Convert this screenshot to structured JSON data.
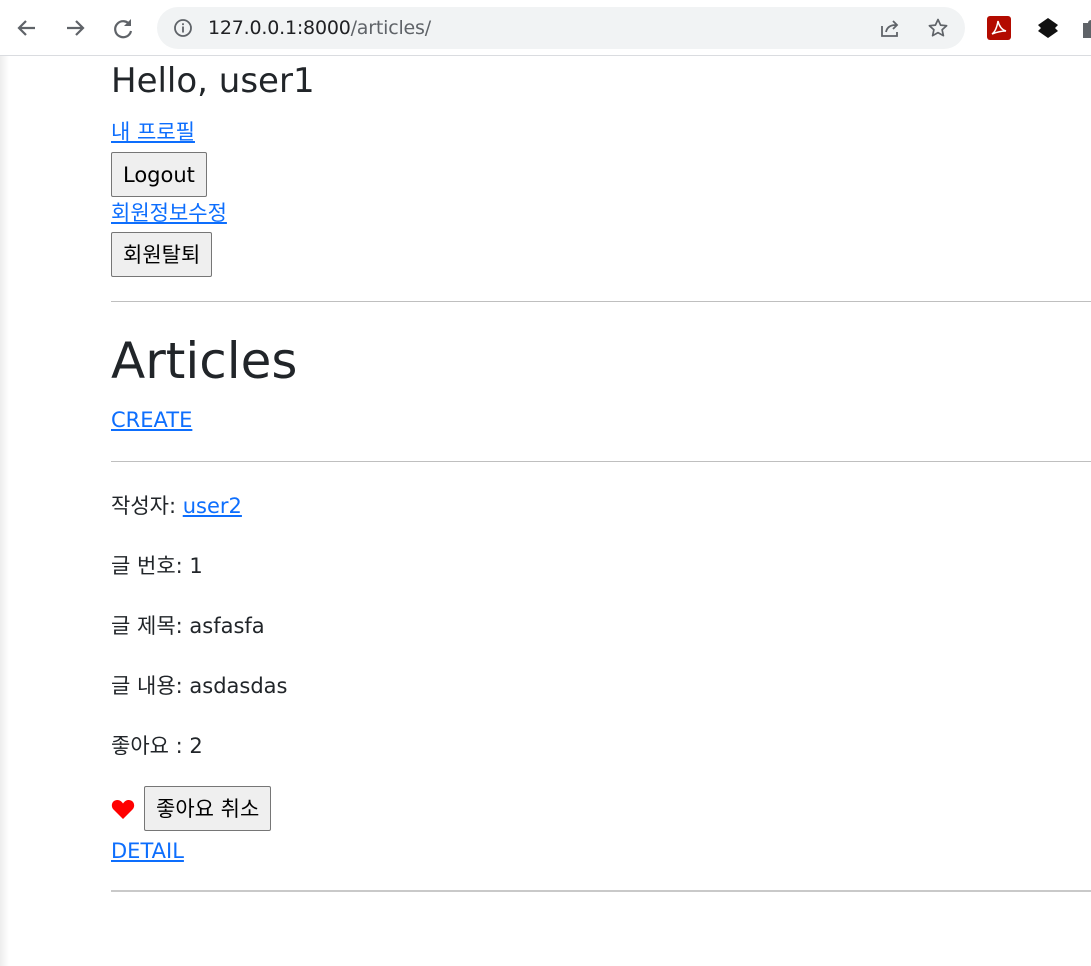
{
  "browser": {
    "url_host": "127.0.0.1:8000",
    "url_path": "/articles/"
  },
  "header": {
    "greeting": "Hello, user1",
    "profile_link": "내 프로필",
    "logout_button": "Logout",
    "edit_account_link": "회원정보수정",
    "delete_account_button": "회원탈퇴"
  },
  "main": {
    "title": "Articles",
    "create_link": "CREATE"
  },
  "article": {
    "author_label": "작성자:",
    "author": "user2",
    "number_label": "글 번호:",
    "number": "1",
    "title_label": "글 제목:",
    "title": "asfasfa",
    "content_label": "글 내용:",
    "content": "asdasdas",
    "likes_label": "좋아요 :",
    "likes": "2",
    "unlike_button": "좋아요 취소",
    "detail_link": "DETAIL"
  },
  "colors": {
    "link": "#0d6efd",
    "heart": "#ff0000",
    "text": "#212529"
  },
  "icons": [
    "back-icon",
    "forward-icon",
    "reload-icon",
    "site-info-icon",
    "share-icon",
    "bookmark-star-icon",
    "pdf-extension-icon",
    "extension-icon",
    "puzzle-icon",
    "heart-icon"
  ]
}
